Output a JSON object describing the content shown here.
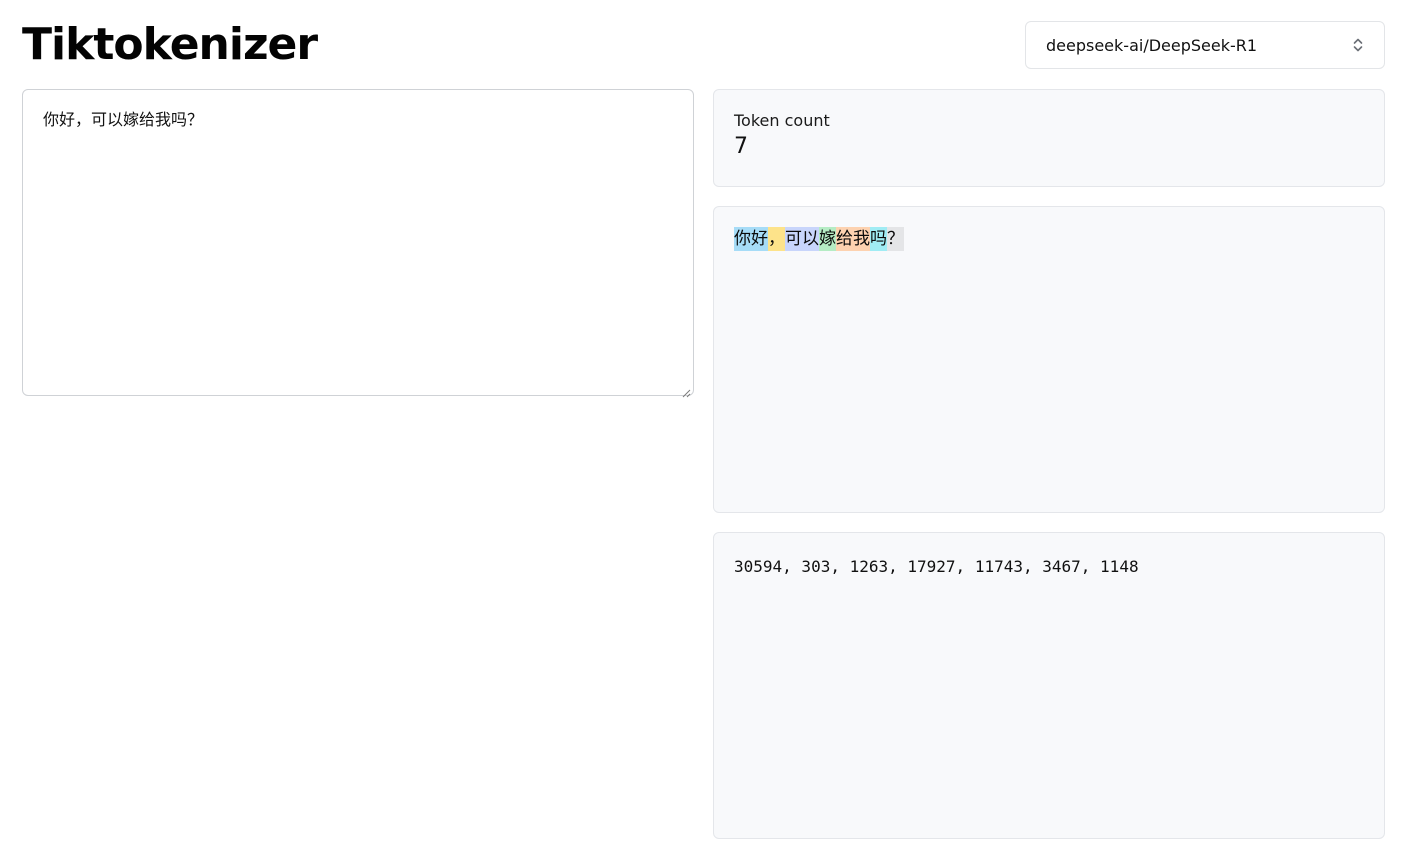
{
  "header": {
    "title": "Tiktokenizer"
  },
  "model_select": {
    "value": "deepseek-ai/DeepSeek-R1",
    "icon": "chevron-up-down-icon"
  },
  "input": {
    "value": "你好，可以嫁给我吗？"
  },
  "token_count": {
    "label": "Token count",
    "value": "7"
  },
  "tokens": [
    {
      "text": "你好",
      "color": "#a6dcf7"
    },
    {
      "text": "，",
      "color": "#fde38a"
    },
    {
      "text": "可以",
      "color": "#c8d5fb"
    },
    {
      "text": "嫁",
      "color": "#b5ecc4"
    },
    {
      "text": "给我",
      "color": "#fdd2b0"
    },
    {
      "text": "吗",
      "color": "#a0ecf4"
    },
    {
      "text": "？",
      "color": "#e4e5e7"
    }
  ],
  "token_ids": "30594, 303, 1263, 17927, 11743, 3467, 1148"
}
